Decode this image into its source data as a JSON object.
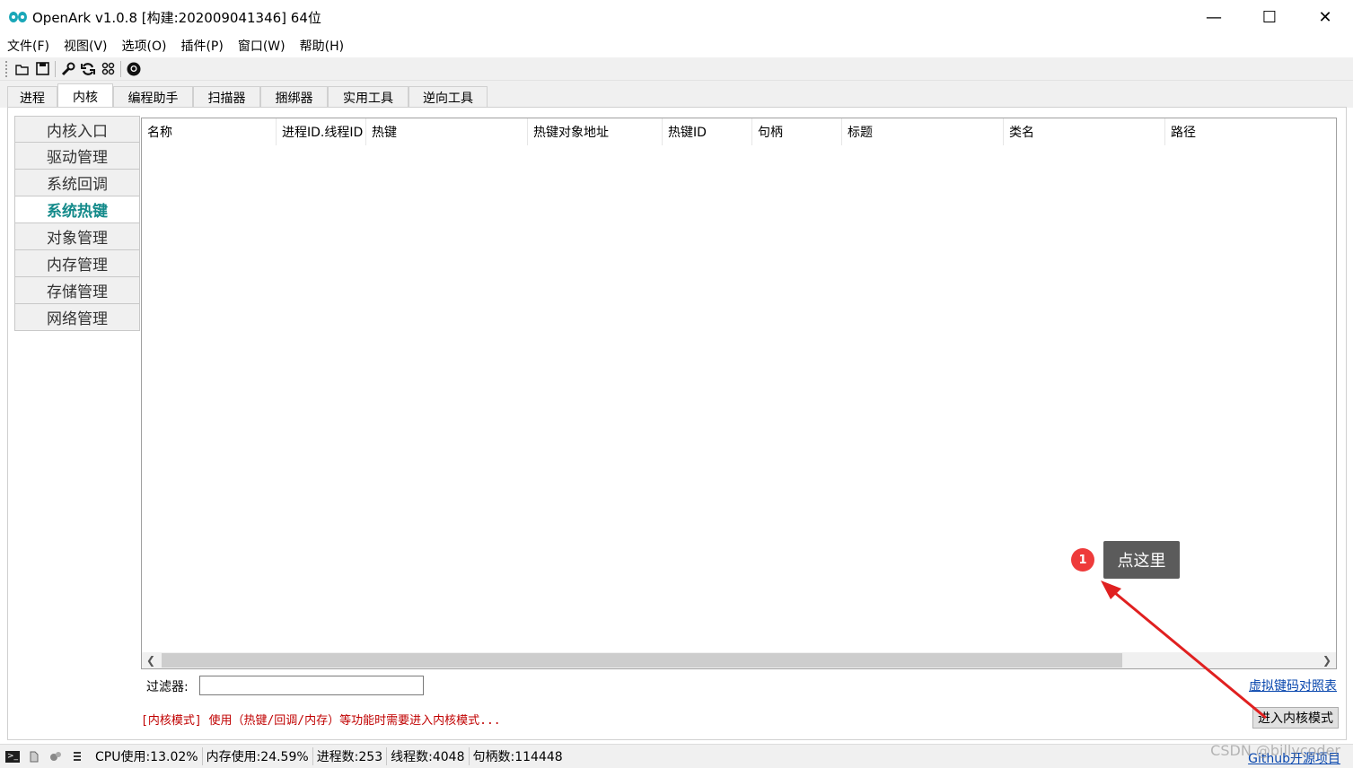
{
  "window": {
    "title": "OpenArk v1.0.8  [构建:202009041346]  64位",
    "minimize_glyph": "—",
    "maximize_glyph": "☐",
    "close_glyph": "✕"
  },
  "menu": [
    "文件(F)",
    "视图(V)",
    "选项(O)",
    "插件(P)",
    "窗口(W)",
    "帮助(H)"
  ],
  "toolbar": [
    "open-folder-icon",
    "save-icon",
    "wrench-icon",
    "refresh-icon",
    "grid-icon",
    "github-icon"
  ],
  "tabs": [
    "进程",
    "内核",
    "编程助手",
    "扫描器",
    "捆绑器",
    "实用工具",
    "逆向工具"
  ],
  "active_tab": "内核",
  "sidenav": [
    "内核入口",
    "驱动管理",
    "系统回调",
    "系统热键",
    "对象管理",
    "内存管理",
    "存储管理",
    "网络管理"
  ],
  "active_nav": "系统热键",
  "table": {
    "columns": [
      "名称",
      "进程ID.线程ID",
      "热键",
      "热键对象地址",
      "热键ID",
      "句柄",
      "标题",
      "类名",
      "路径"
    ],
    "rows": []
  },
  "filter": {
    "label": "过滤器:",
    "value": ""
  },
  "vk_link": "虚拟键码对照表",
  "notice": "[内核模式] 使用（热键/回调/内存）等功能时需要进入内核模式...",
  "kernel_button": "进入内核模式",
  "status": {
    "cpu": "CPU使用:13.02%",
    "mem": "内存使用:24.59%",
    "procs": "进程数:253",
    "threads": "线程数:4048",
    "handles": "句柄数:114448"
  },
  "github_link": "Github开源项目",
  "watermark": "CSDN @billycoder",
  "annotation": {
    "badge": "1",
    "callout": "点这里"
  },
  "colors": {
    "accent_teal": "#138a8a",
    "notice_red": "#c00000",
    "link_blue": "#0645ad",
    "badge_red": "#ee3b3b",
    "arrow_red": "#e02020"
  }
}
